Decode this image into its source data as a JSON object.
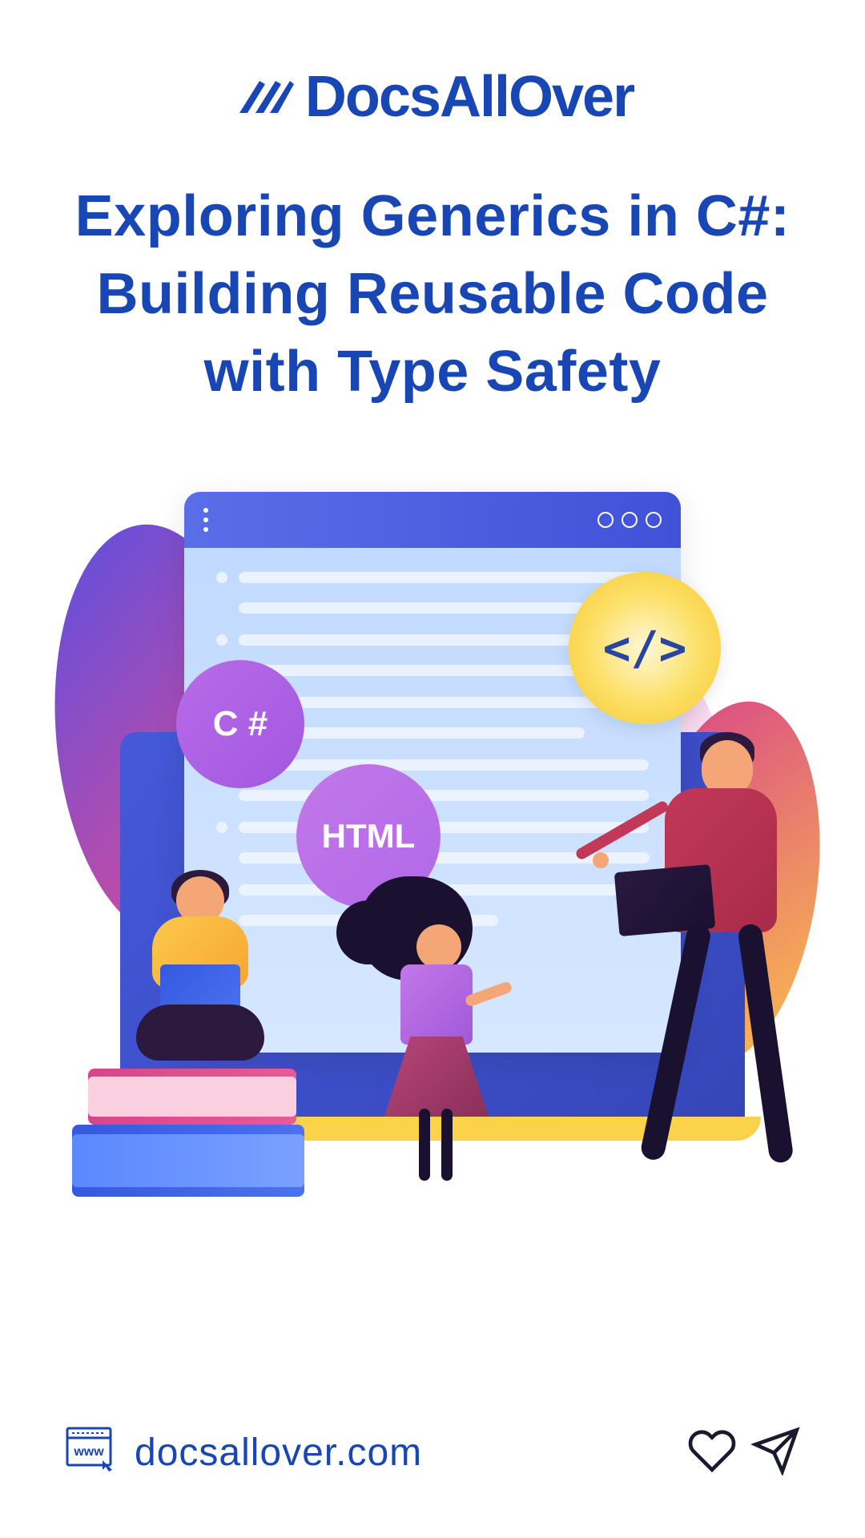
{
  "brand_name": "DocsAllOver",
  "headline": "Exploring Generics in C#: Building Reusable Code with Type Safety",
  "badges": {
    "csharp": "C #",
    "html": "HTML",
    "code_tag": "</>"
  },
  "footer": {
    "www_label": "www",
    "url": "docsallover.com"
  },
  "colors": {
    "brand_blue": "#1946b5"
  }
}
